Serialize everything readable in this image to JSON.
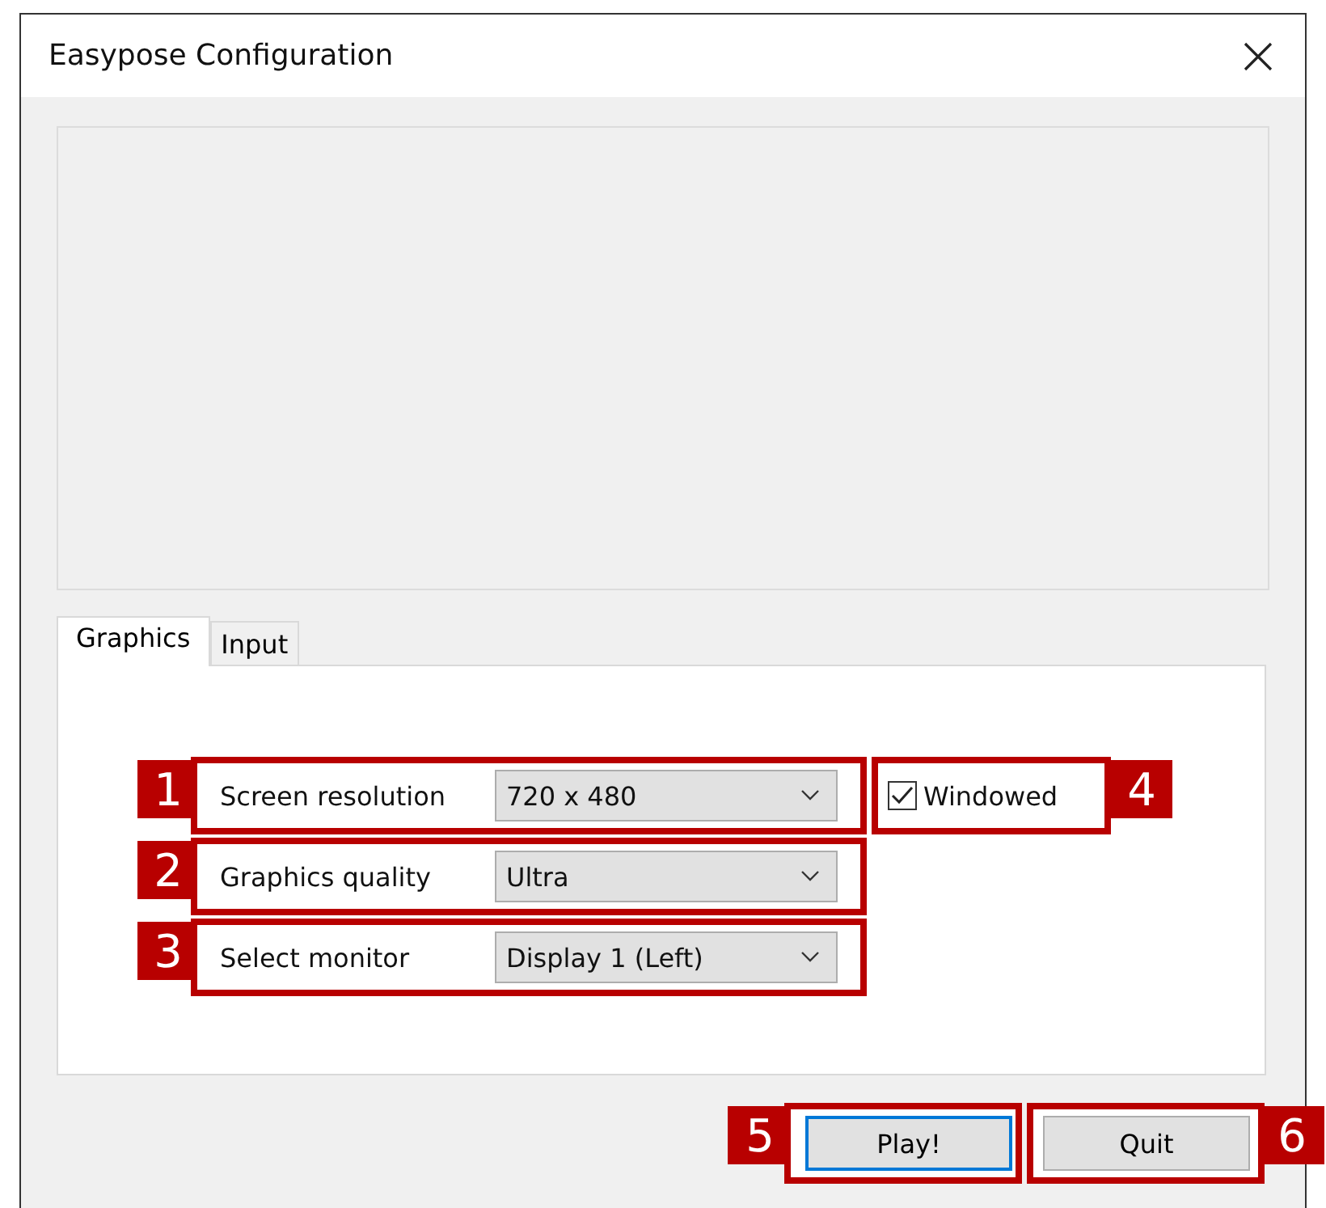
{
  "window": {
    "title": "Easypose Configuration"
  },
  "tabs": [
    {
      "label": "Graphics",
      "selected": true
    },
    {
      "label": "Input",
      "selected": false
    }
  ],
  "settings": [
    {
      "callout": "1",
      "label": "Screen resolution",
      "value": "720 x 480"
    },
    {
      "callout": "2",
      "label": "Graphics quality",
      "value": "Ultra"
    },
    {
      "callout": "3",
      "label": "Select monitor",
      "value": "Display 1 (Left)"
    }
  ],
  "windowed": {
    "callout": "4",
    "label": "Windowed",
    "checked": true
  },
  "buttons": [
    {
      "callout": "5",
      "label": "Play!",
      "default": true
    },
    {
      "callout": "6",
      "label": "Quit",
      "default": false
    }
  ]
}
